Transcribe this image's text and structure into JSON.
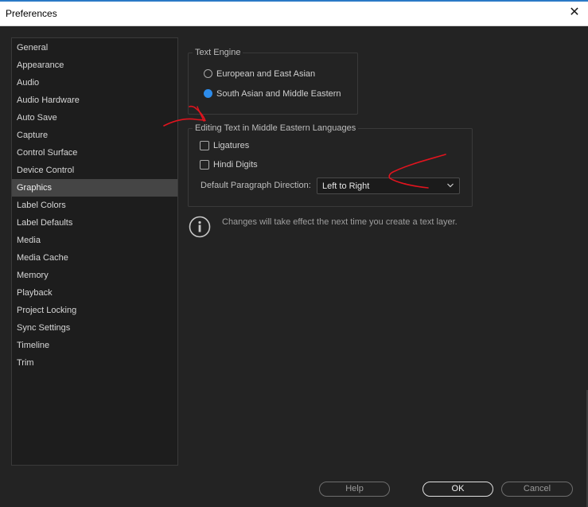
{
  "window": {
    "title": "Preferences",
    "close_glyph": "✕"
  },
  "sidebar": {
    "items": [
      {
        "label": "General"
      },
      {
        "label": "Appearance"
      },
      {
        "label": "Audio"
      },
      {
        "label": "Audio Hardware"
      },
      {
        "label": "Auto Save"
      },
      {
        "label": "Capture"
      },
      {
        "label": "Control Surface"
      },
      {
        "label": "Device Control"
      },
      {
        "label": "Graphics",
        "selected": true
      },
      {
        "label": "Label Colors"
      },
      {
        "label": "Label Defaults"
      },
      {
        "label": "Media"
      },
      {
        "label": "Media Cache"
      },
      {
        "label": "Memory"
      },
      {
        "label": "Playback"
      },
      {
        "label": "Project Locking"
      },
      {
        "label": "Sync Settings"
      },
      {
        "label": "Timeline"
      },
      {
        "label": "Trim"
      }
    ]
  },
  "text_engine": {
    "legend": "Text Engine",
    "options": [
      {
        "label": "European and East Asian",
        "checked": false
      },
      {
        "label": "South Asian and Middle Eastern",
        "checked": true
      }
    ]
  },
  "middle_eastern": {
    "legend": "Editing Text in Middle Eastern Languages",
    "ligatures_label": "Ligatures",
    "ligatures_checked": false,
    "hindi_digits_label": "Hindi Digits",
    "hindi_digits_checked": false,
    "direction_label": "Default Paragraph Direction:",
    "direction_value": "Left to Right"
  },
  "info": {
    "icon": "info-icon",
    "text": "Changes will take effect the next time you create a text layer."
  },
  "buttons": {
    "help": "Help",
    "ok": "OK",
    "cancel": "Cancel"
  },
  "colors": {
    "background": "#232323",
    "sidebar_selected": "#454545",
    "radio_selected": "#2d8ceb",
    "annotation_ink": "#e0141e"
  }
}
